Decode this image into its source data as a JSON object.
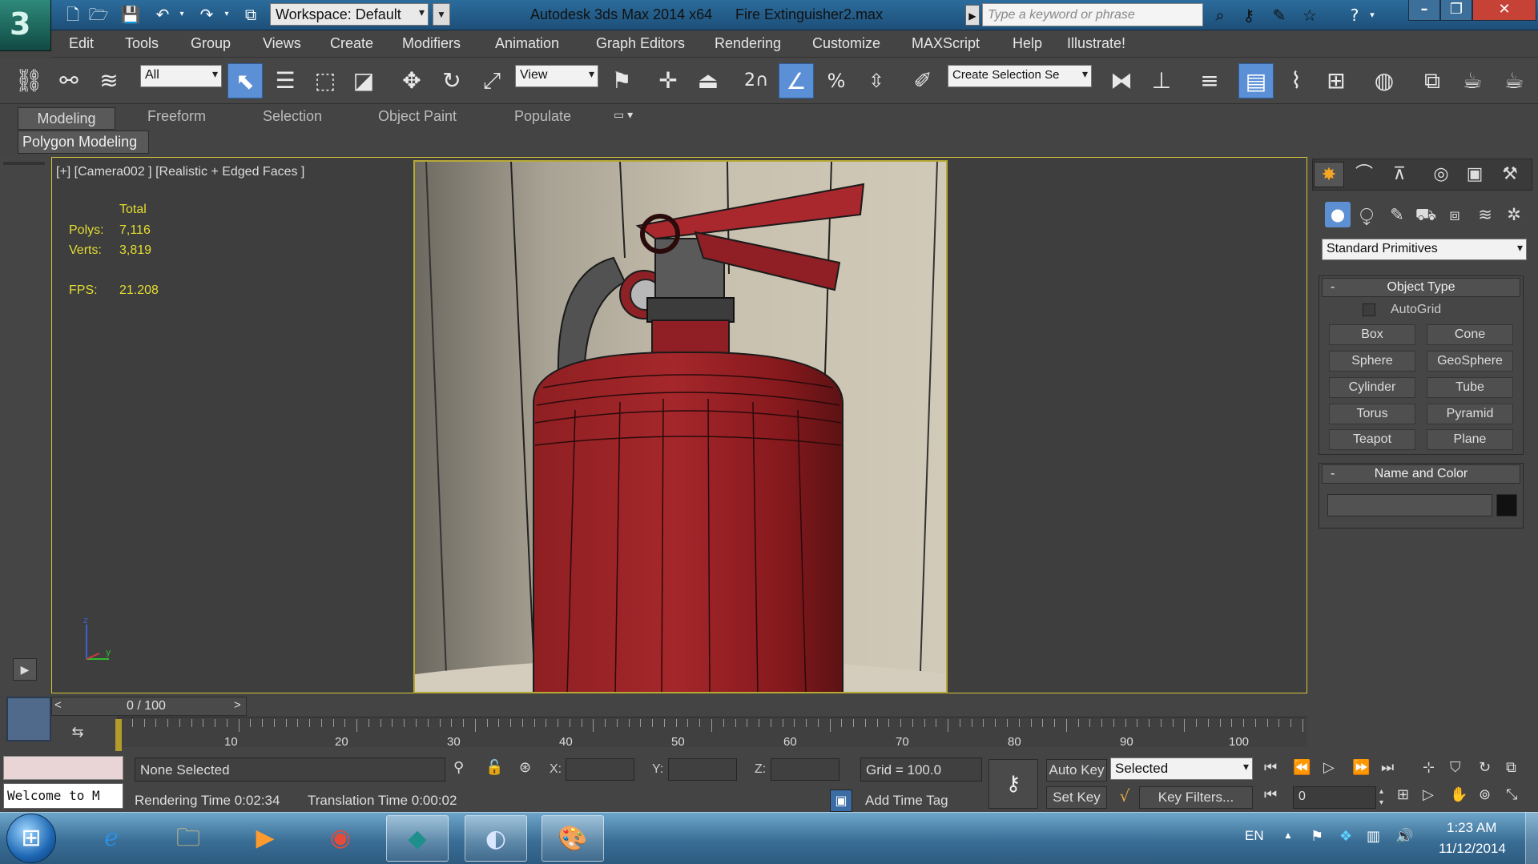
{
  "titlebar": {
    "workspace_label": "Workspace: Default",
    "app_title": "Autodesk 3ds Max  2014 x64",
    "file_name": "Fire Extinguisher2.max",
    "search_placeholder": "Type a keyword or phrase"
  },
  "menu": [
    "Edit",
    "Tools",
    "Group",
    "Views",
    "Create",
    "Modifiers",
    "Animation",
    "Graph Editors",
    "Rendering",
    "Customize",
    "MAXScript",
    "Help",
    "Illustrate!"
  ],
  "toolbar": {
    "selection_filter": "All",
    "ref_coord": "View",
    "snap_toggle": "2",
    "named_selection_placeholder": "Create Selection Se"
  },
  "ribbon": {
    "tabs": [
      "Modeling",
      "Freeform",
      "Selection",
      "Object Paint",
      "Populate"
    ],
    "active_tab": "Modeling",
    "subpanel": "Polygon Modeling"
  },
  "viewport": {
    "label": "[+] [Camera002 ] [Realistic + Edged Faces ]",
    "stats": {
      "total_label": "Total",
      "polys_label": "Polys:",
      "polys": "7,116",
      "verts_label": "Verts:",
      "verts": "3,819",
      "fps_label": "FPS:",
      "fps": "21.208"
    },
    "gizmo": {
      "z": "z",
      "y": "y"
    }
  },
  "command_panel": {
    "category": "Standard Primitives",
    "object_type": {
      "title": "Object Type",
      "collapse": "-",
      "autogrid_label": "AutoGrid",
      "autogrid_checked": false,
      "buttons": [
        "Box",
        "Cone",
        "Sphere",
        "GeoSphere",
        "Cylinder",
        "Tube",
        "Torus",
        "Pyramid",
        "Teapot",
        "Plane"
      ]
    },
    "name_color": {
      "title": "Name and Color",
      "collapse": "-",
      "name_value": "",
      "swatch_color": "#111111"
    }
  },
  "timeline": {
    "frame": "0 / 100",
    "prev": "<",
    "next": ">",
    "ticks": [
      "10",
      "20",
      "30",
      "40",
      "50",
      "60",
      "70",
      "80",
      "90",
      "100"
    ]
  },
  "status": {
    "maxscript": "Welcome to M",
    "selection": "None Selected",
    "rendering_time": "Rendering Time  0:02:34",
    "translation_time": "Translation Time  0:00:02",
    "x_label": "X:",
    "y_label": "Y:",
    "z_label": "Z:",
    "grid": "Grid = 100.0",
    "add_time_tag": "Add Time Tag",
    "auto_key": "Auto Key",
    "set_key": "Set Key",
    "key_mode": "Selected",
    "key_filters": "Key Filters...",
    "current_frame": "0"
  },
  "taskbar": {
    "lang": "EN",
    "time": "1:23 AM",
    "date": "11/12/2014"
  },
  "colors": {
    "accent": "#5b8fd6",
    "viewport_border": "#d8c63a",
    "stats": "#e4dc32",
    "extinguisher": "#9b2226"
  }
}
